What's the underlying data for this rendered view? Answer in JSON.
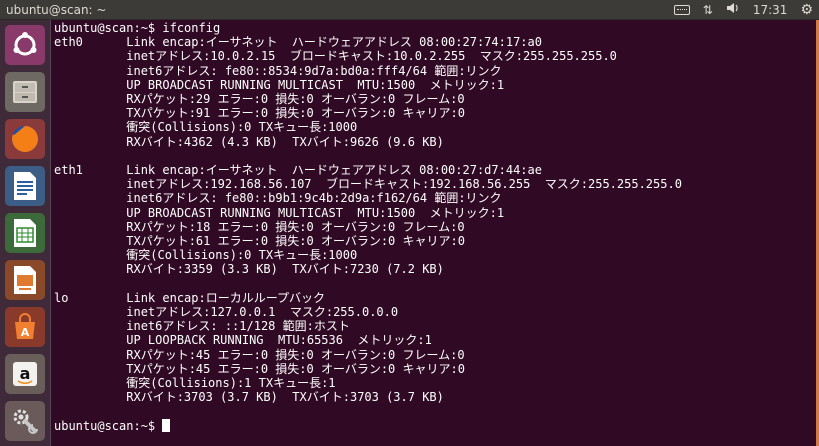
{
  "window": {
    "title": "ubuntu@scan: ~"
  },
  "indicators": {
    "keyboard_icon": "keyboard-icon",
    "network_icon": "network-arrows-icon",
    "volume_icon": "speaker-icon",
    "time": "17:31",
    "power_icon": "gear-icon"
  },
  "launcher": {
    "items": [
      {
        "name": "ubuntu-dash",
        "icon": "ubuntu-logo-icon"
      },
      {
        "name": "files",
        "icon": "file-cabinet-icon"
      },
      {
        "name": "firefox",
        "icon": "firefox-icon"
      },
      {
        "name": "libreoffice-writer",
        "icon": "writer-document-icon"
      },
      {
        "name": "libreoffice-calc",
        "icon": "calc-spreadsheet-icon"
      },
      {
        "name": "libreoffice-impress",
        "icon": "impress-presentation-icon"
      },
      {
        "name": "ubuntu-software",
        "icon": "shopping-bag-icon"
      },
      {
        "name": "amazon",
        "icon": "amazon-icon"
      },
      {
        "name": "system-settings",
        "icon": "wrench-gear-icon"
      }
    ]
  },
  "terminal": {
    "lines": [
      "ubuntu@scan:~$ ifconfig",
      "eth0      Link encap:イーサネット  ハードウェアアドレス 08:00:27:74:17:a0",
      "          inetアドレス:10.0.2.15  ブロードキャスト:10.0.2.255  マスク:255.255.255.0",
      "          inet6アドレス: fe80::8534:9d7a:bd0a:fff4/64 範囲:リンク",
      "          UP BROADCAST RUNNING MULTICAST  MTU:1500  メトリック:1",
      "          RXパケット:29 エラー:0 損失:0 オーバラン:0 フレーム:0",
      "          TXパケット:91 エラー:0 損失:0 オーバラン:0 キャリア:0",
      "          衝突(Collisions):0 TXキュー長:1000",
      "          RXバイト:4362 (4.3 KB)  TXバイト:9626 (9.6 KB)",
      "",
      "eth1      Link encap:イーサネット  ハードウェアアドレス 08:00:27:d7:44:ae",
      "          inetアドレス:192.168.56.107  ブロードキャスト:192.168.56.255  マスク:255.255.255.0",
      "          inet6アドレス: fe80::b9b1:9c4b:2d9a:f162/64 範囲:リンク",
      "          UP BROADCAST RUNNING MULTICAST  MTU:1500  メトリック:1",
      "          RXパケット:18 エラー:0 損失:0 オーバラン:0 フレーム:0",
      "          TXパケット:61 エラー:0 損失:0 オーバラン:0 キャリア:0",
      "          衝突(Collisions):0 TXキュー長:1000",
      "          RXバイト:3359 (3.3 KB)  TXバイト:7230 (7.2 KB)",
      "",
      "lo        Link encap:ローカルループバック",
      "          inetアドレス:127.0.0.1  マスク:255.0.0.0",
      "          inet6アドレス: ::1/128 範囲:ホスト",
      "          UP LOOPBACK RUNNING  MTU:65536  メトリック:1",
      "          RXパケット:45 エラー:0 損失:0 オーバラン:0 フレーム:0",
      "          TXパケット:45 エラー:0 損失:0 オーバラン:0 キャリア:0",
      "          衝突(Collisions):1 TXキュー長:1",
      "          RXバイト:3703 (3.7 KB)  TXバイト:3703 (3.7 KB)",
      "",
      "ubuntu@scan:~$ "
    ]
  }
}
